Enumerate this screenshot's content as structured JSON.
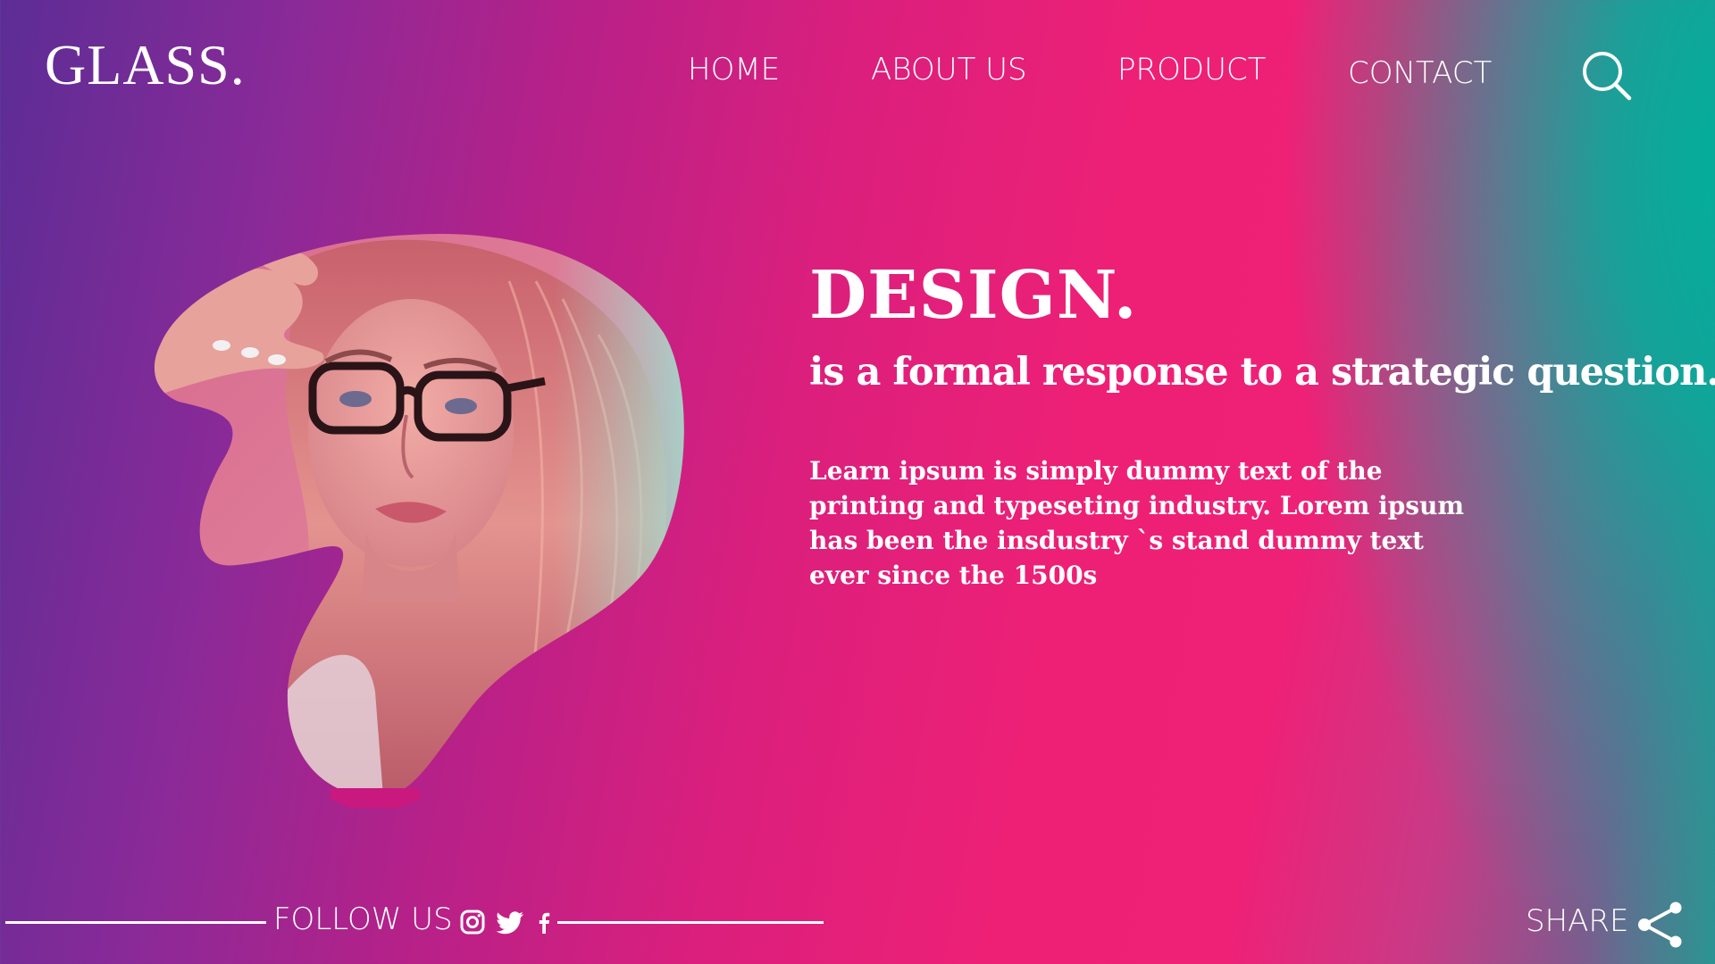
{
  "brand": {
    "logo_text": "GLASS."
  },
  "nav": {
    "items": [
      {
        "label": "HOME"
      },
      {
        "label": "ABOUT US"
      },
      {
        "label": "PRODUCT"
      },
      {
        "label": "CONTACT"
      }
    ],
    "search_icon": "search-icon"
  },
  "hero": {
    "image_subject": "woman with long blonde hair adjusting black-framed glasses",
    "headline": "DESIGN.",
    "subheadline": "is a formal response to a strategic question.",
    "body_lines": [
      "Learn ipsum is simply dummy text of the",
      "printing and typeseting industry. Lorem ipsum",
      "has been the insdustry `s stand dummy text",
      "ever since the 1500s"
    ]
  },
  "footer": {
    "follow_label": "FOLLOW US",
    "social_icons": [
      "instagram-icon",
      "twitter-icon",
      "facebook-icon"
    ],
    "share_label": "SHARE",
    "share_icon": "share-icon"
  },
  "colors": {
    "purple": "#5c2d95",
    "magenta": "#ee2076",
    "teal": "#00b09b",
    "text": "#ffffff"
  }
}
